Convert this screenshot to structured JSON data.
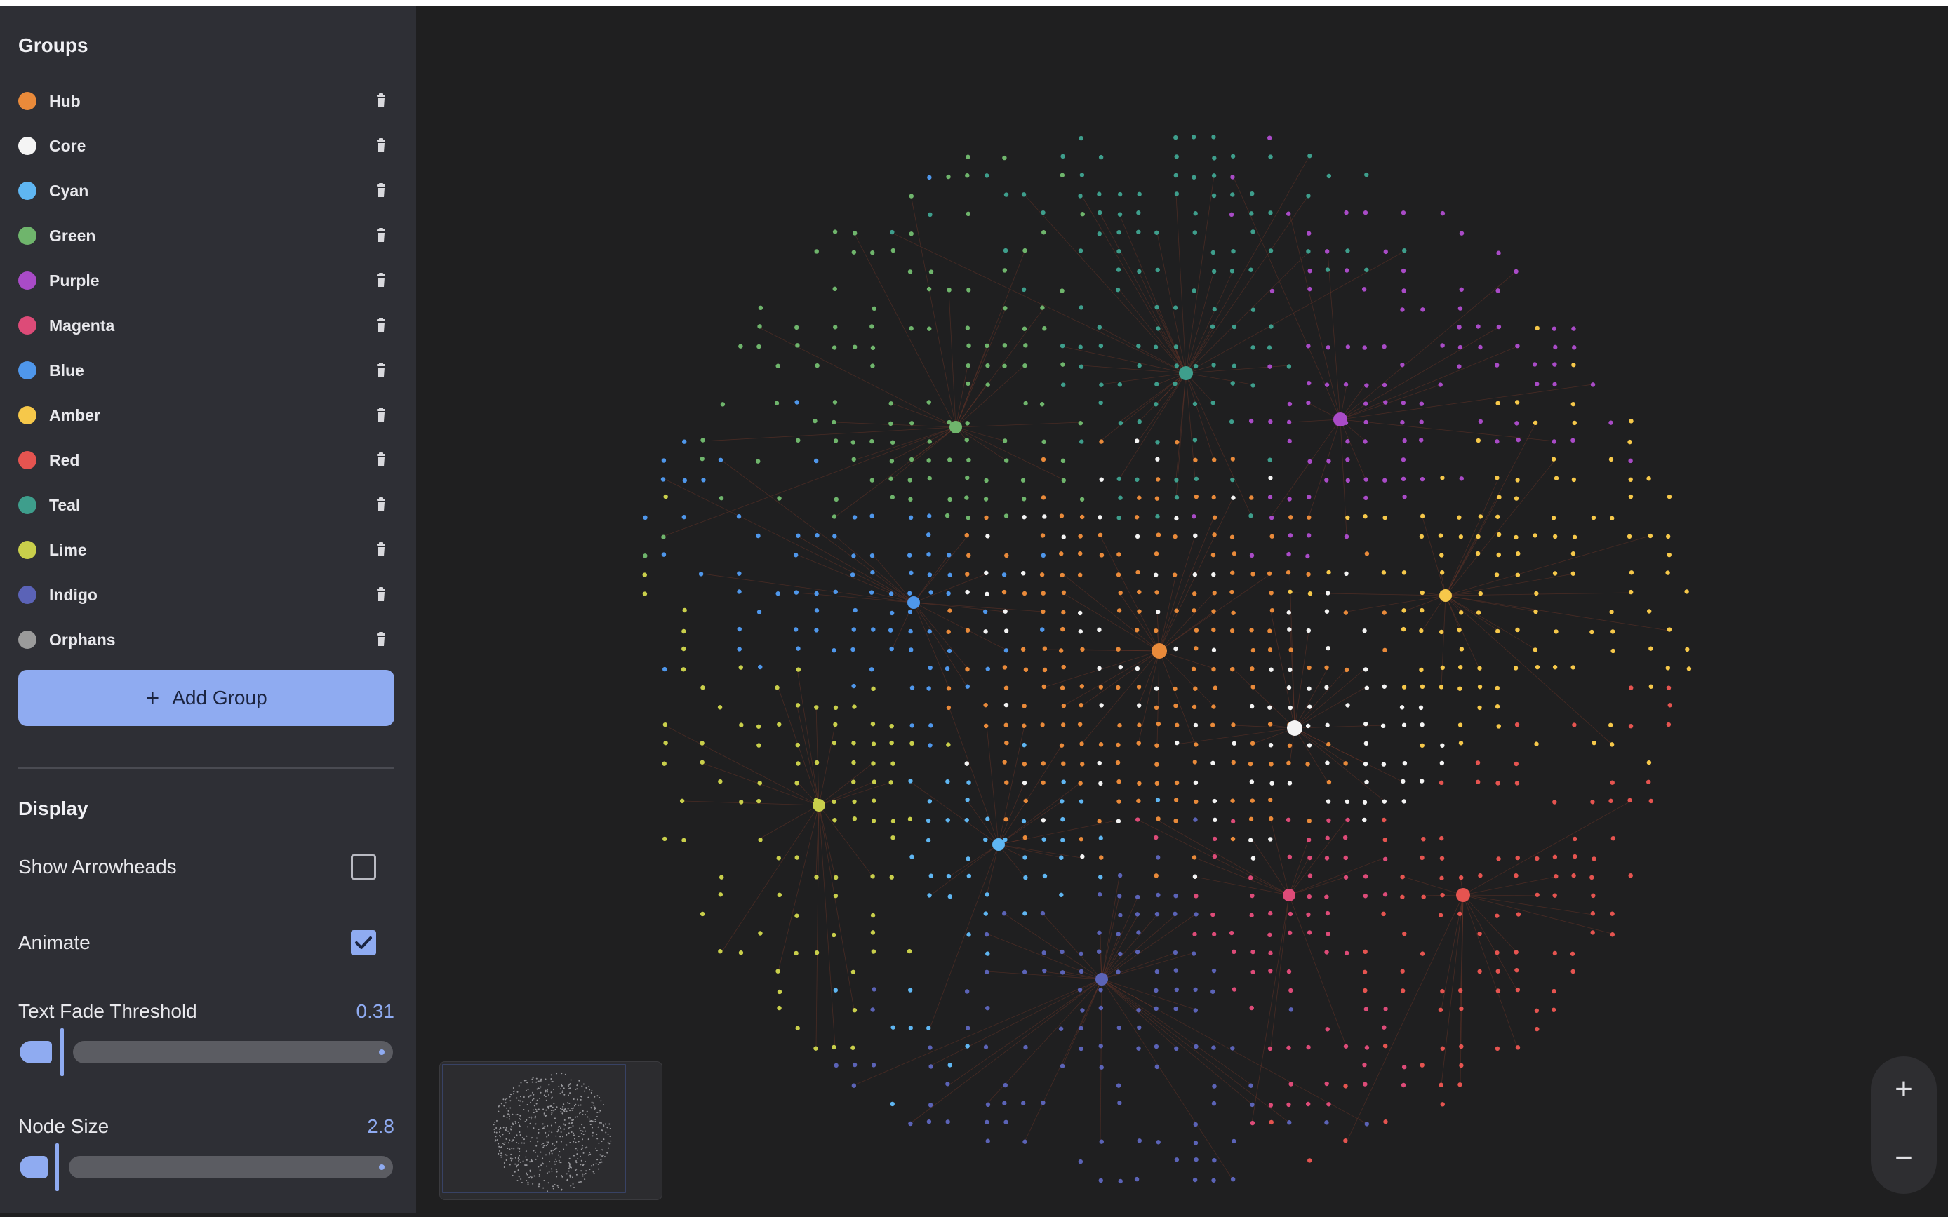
{
  "groups_panel": {
    "title": "Groups",
    "items": [
      {
        "label": "Hub",
        "color": "#e98a3a"
      },
      {
        "label": "Core",
        "color": "#f4f4f4"
      },
      {
        "label": "Cyan",
        "color": "#5fb6f2"
      },
      {
        "label": "Green",
        "color": "#6fb56c"
      },
      {
        "label": "Purple",
        "color": "#a94bc7"
      },
      {
        "label": "Magenta",
        "color": "#dd4b78"
      },
      {
        "label": "Blue",
        "color": "#4f97eb"
      },
      {
        "label": "Amber",
        "color": "#f6c84a"
      },
      {
        "label": "Red",
        "color": "#e55450"
      },
      {
        "label": "Teal",
        "color": "#3e9e8c"
      },
      {
        "label": "Lime",
        "color": "#c9cf4b"
      },
      {
        "label": "Indigo",
        "color": "#5b63b7"
      },
      {
        "label": "Orphans",
        "color": "#9b9b9b"
      }
    ],
    "add_button_label": "Add Group",
    "add_button_icon": "+"
  },
  "display_panel": {
    "title": "Display",
    "show_arrowheads": {
      "label": "Show Arrowheads",
      "checked": false
    },
    "animate": {
      "label": "Animate",
      "checked": true
    },
    "text_fade": {
      "label": "Text Fade Threshold",
      "value": "0.31"
    },
    "node_size": {
      "label": "Node Size",
      "value": "2.8"
    }
  },
  "zoom": {
    "in_label": "+",
    "out_label": "−"
  },
  "colors": {
    "accent": "#8fabf1",
    "sidebar_bg": "#2e2f35",
    "canvas_bg": "#1f1f20",
    "edge": "#7a3a2a"
  }
}
